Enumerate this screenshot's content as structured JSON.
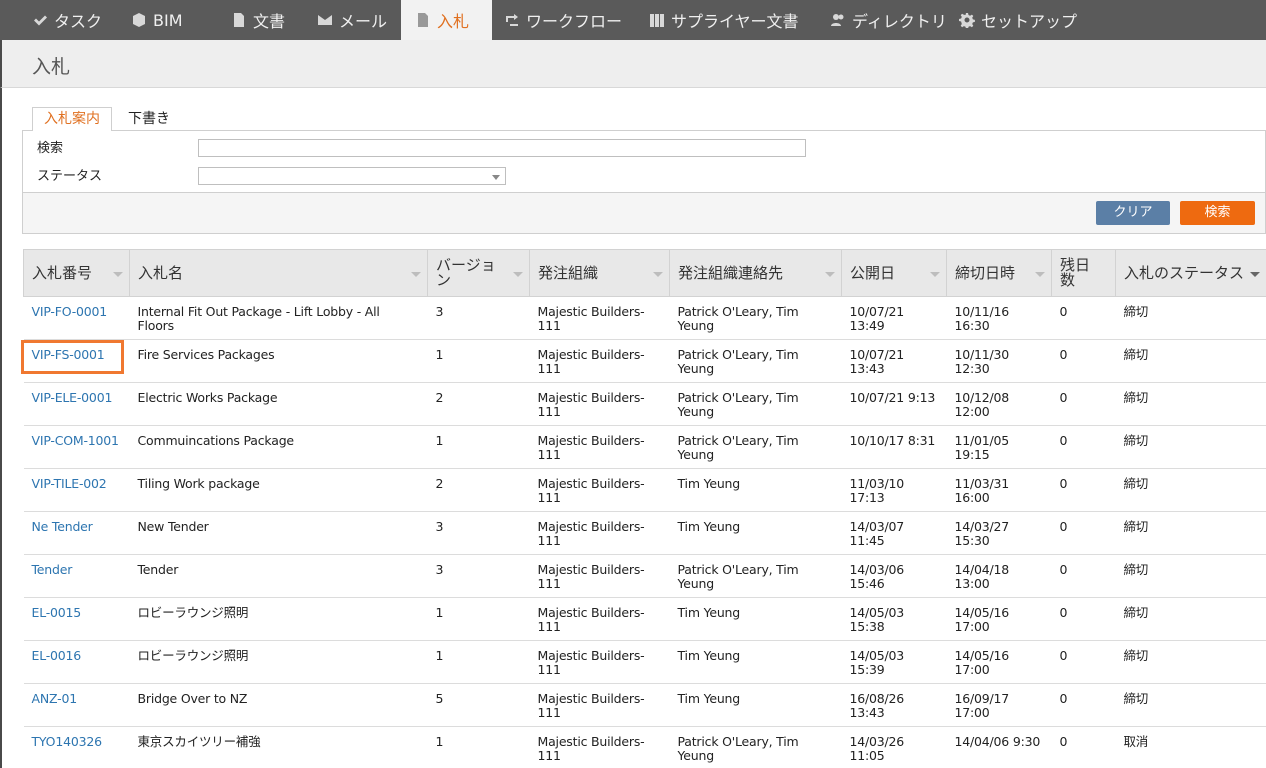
{
  "nav": {
    "items": [
      {
        "label": "タスク",
        "icon": "check-icon"
      },
      {
        "label": "BIM",
        "icon": "cube-icon"
      },
      {
        "label": "文書",
        "icon": "document-icon"
      },
      {
        "label": "メール",
        "icon": "envelope-icon"
      },
      {
        "label": "入札",
        "icon": "tender-icon",
        "active": true
      },
      {
        "label": "ワークフロー",
        "icon": "workflow-icon"
      },
      {
        "label": "サプライヤー文書",
        "icon": "binders-icon"
      },
      {
        "label": "ディレクトリ",
        "icon": "users-icon"
      },
      {
        "label": "セットアップ",
        "icon": "gear-icon"
      }
    ]
  },
  "page": {
    "title": "入札"
  },
  "tabs": {
    "active": "入札案内",
    "other": "下書き"
  },
  "search": {
    "search_label": "検索",
    "search_value": "",
    "status_label": "ステータス",
    "status_value": "",
    "clear_button": "クリア",
    "search_button": "検索"
  },
  "table": {
    "headers": [
      "入札番号",
      "入札名",
      "バージョン",
      "発注組織",
      "発注組織連絡先",
      "公開日",
      "締切日時",
      "残日数",
      "入札のステータス"
    ],
    "rows": [
      [
        "VIP-FO-0001",
        "Internal Fit Out Package - Lift Lobby - All Floors",
        "3",
        "Majestic Builders-111",
        "Patrick O'Leary, Tim Yeung",
        "10/07/21 13:49",
        "10/11/16 16:30",
        "0",
        "締切"
      ],
      [
        "VIP-FS-0001",
        "Fire Services Packages",
        "1",
        "Majestic Builders-111",
        "Patrick O'Leary, Tim Yeung",
        "10/07/21 13:43",
        "10/11/30 12:30",
        "0",
        "締切"
      ],
      [
        "VIP-ELE-0001",
        "Electric Works Package",
        "2",
        "Majestic Builders-111",
        "Patrick O'Leary, Tim Yeung",
        "10/07/21 9:13",
        "10/12/08 12:00",
        "0",
        "締切"
      ],
      [
        "VIP-COM-1001",
        "Commuincations Package",
        "1",
        "Majestic Builders-111",
        "Patrick O'Leary, Tim Yeung",
        "10/10/17 8:31",
        "11/01/05 19:15",
        "0",
        "締切"
      ],
      [
        "VIP-TILE-002",
        "Tiling Work package",
        "2",
        "Majestic Builders-111",
        "Tim Yeung",
        "11/03/10 17:13",
        "11/03/31 16:00",
        "0",
        "締切"
      ],
      [
        "Ne Tender",
        "New Tender",
        "3",
        "Majestic Builders-111",
        "Tim Yeung",
        "14/03/07 11:45",
        "14/03/27 15:30",
        "0",
        "締切"
      ],
      [
        "Tender",
        "Tender",
        "3",
        "Majestic Builders-111",
        "Patrick O'Leary, Tim Yeung",
        "14/03/06 15:46",
        "14/04/18 13:00",
        "0",
        "締切"
      ],
      [
        "EL-0015",
        "ロビーラウンジ照明",
        "1",
        "Majestic Builders-111",
        "Tim Yeung",
        "14/05/03 15:38",
        "14/05/16 17:00",
        "0",
        "締切"
      ],
      [
        "EL-0016",
        "ロビーラウンジ照明",
        "1",
        "Majestic Builders-111",
        "Tim Yeung",
        "14/05/03 15:39",
        "14/05/16 17:00",
        "0",
        "締切"
      ],
      [
        "ANZ-01",
        "Bridge Over to NZ",
        "5",
        "Majestic Builders-111",
        "Tim Yeung",
        "16/08/26 13:43",
        "16/09/17 17:00",
        "0",
        "締切"
      ],
      [
        "TYO140326",
        "東京スカイツリー補強",
        "1",
        "Majestic Builders-111",
        "Patrick O'Leary, Tim Yeung",
        "14/03/26 11:05",
        "14/04/06 9:30",
        "0",
        "取消"
      ]
    ]
  }
}
